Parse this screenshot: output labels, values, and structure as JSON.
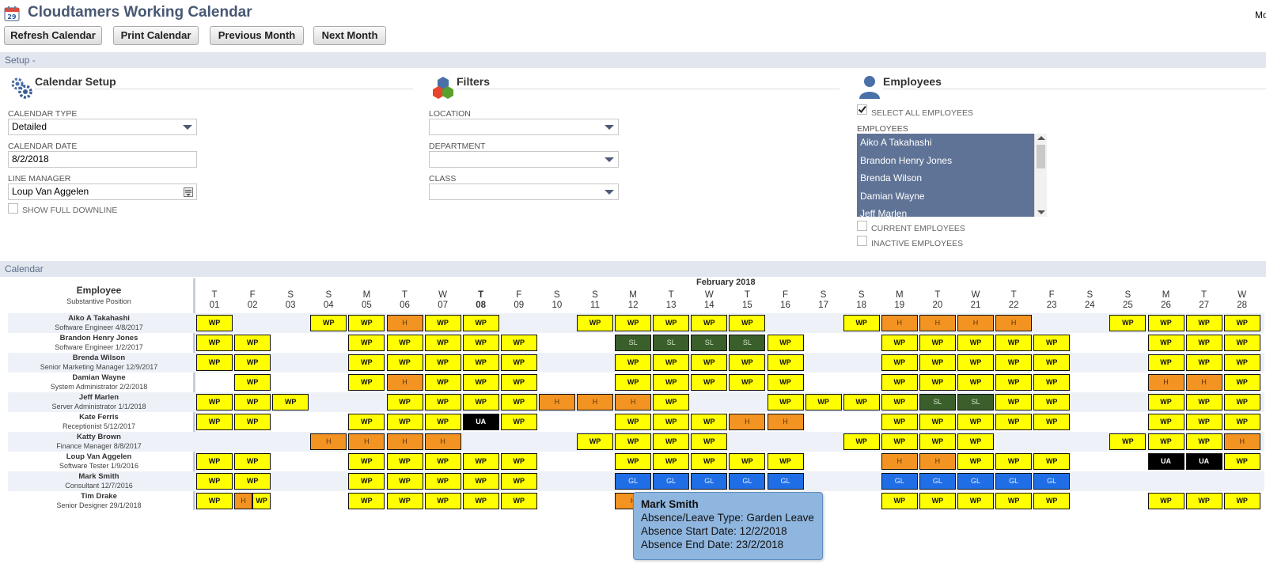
{
  "app": {
    "title": "Cloudtamers Working Calendar",
    "corner_text": "Mo"
  },
  "toolbar": {
    "refresh": "Refresh Calendar",
    "print": "Print Calendar",
    "previous": "Previous Month",
    "next": "Next Month"
  },
  "setup": {
    "bar_label": "Setup -",
    "calendar_setup": {
      "heading": "Calendar Setup",
      "calendar_type_label": "CALENDAR TYPE",
      "calendar_type_value": "Detailed",
      "calendar_date_label": "CALENDAR DATE",
      "calendar_date_value": "8/2/2018",
      "line_manager_label": "LINE MANAGER",
      "line_manager_value": "Loup Van Aggelen",
      "show_full_downline": "SHOW FULL DOWNLINE"
    },
    "filters": {
      "heading": "Filters",
      "location_label": "LOCATION",
      "department_label": "DEPARTMENT",
      "class_label": "CLASS"
    },
    "employees": {
      "heading": "Employees",
      "select_all": "SELECT ALL EMPLOYEES",
      "select_all_checked": true,
      "list_label": "EMPLOYEES",
      "list": [
        "Aiko A Takahashi",
        "Brandon Henry Jones",
        "Brenda Wilson",
        "Damian Wayne",
        "Jeff Marlen"
      ],
      "current_employees": "CURRENT EMPLOYEES",
      "inactive_employees": "INACTIVE EMPLOYEES"
    }
  },
  "calendar": {
    "bar_label": "Calendar",
    "month_label": "February 2018",
    "employee_header": "Employee",
    "employee_subheader": "Substantive Position",
    "days": [
      {
        "dow": "T",
        "num": "01"
      },
      {
        "dow": "F",
        "num": "02"
      },
      {
        "dow": "S",
        "num": "03"
      },
      {
        "dow": "S",
        "num": "04"
      },
      {
        "dow": "M",
        "num": "05"
      },
      {
        "dow": "T",
        "num": "06"
      },
      {
        "dow": "W",
        "num": "07"
      },
      {
        "dow": "T",
        "num": "08"
      },
      {
        "dow": "F",
        "num": "09"
      },
      {
        "dow": "S",
        "num": "10"
      },
      {
        "dow": "S",
        "num": "11"
      },
      {
        "dow": "M",
        "num": "12"
      },
      {
        "dow": "T",
        "num": "13"
      },
      {
        "dow": "W",
        "num": "14"
      },
      {
        "dow": "T",
        "num": "15"
      },
      {
        "dow": "F",
        "num": "16"
      },
      {
        "dow": "S",
        "num": "17"
      },
      {
        "dow": "S",
        "num": "18"
      },
      {
        "dow": "M",
        "num": "19"
      },
      {
        "dow": "T",
        "num": "20"
      },
      {
        "dow": "W",
        "num": "21"
      },
      {
        "dow": "T",
        "num": "22"
      },
      {
        "dow": "F",
        "num": "23"
      },
      {
        "dow": "S",
        "num": "24"
      },
      {
        "dow": "S",
        "num": "25"
      },
      {
        "dow": "M",
        "num": "26"
      },
      {
        "dow": "T",
        "num": "27"
      },
      {
        "dow": "W",
        "num": "28"
      }
    ],
    "highlight_day": "08",
    "legend_colors": {
      "WP": "#ffff00",
      "H": "#f39321",
      "SL": "#3b5f2b",
      "GL": "#1f6ee6",
      "UA": "#000000"
    },
    "rows": [
      {
        "name": "Aiko A Takahashi",
        "position": "Software Engineer 4/8/2017",
        "cells": [
          "WP",
          "",
          "",
          "WP",
          "WP",
          "H",
          "WP",
          "WP",
          "",
          "",
          "WP",
          "WP",
          "WP",
          "WP",
          "WP",
          "",
          "",
          "WP",
          "H",
          "H",
          "H",
          "H",
          "",
          "",
          "WP",
          "WP",
          "WP",
          "WP"
        ]
      },
      {
        "name": "Brandon Henry Jones",
        "position": "Software Engineer 1/2/2017",
        "cells": [
          "WP",
          "WP",
          "",
          "",
          "WP",
          "WP",
          "WP",
          "WP",
          "WP",
          "",
          "",
          "SL",
          "SL",
          "SL",
          "SL",
          "WP",
          "",
          "",
          "WP",
          "WP",
          "WP",
          "WP",
          "WP",
          "",
          "",
          "WP",
          "WP",
          "WP"
        ]
      },
      {
        "name": "Brenda Wilson",
        "position": "Senior Marketing Manager 12/9/2017",
        "cells": [
          "WP",
          "WP",
          "",
          "",
          "WP",
          "WP",
          "WP",
          "WP",
          "WP",
          "",
          "",
          "WP",
          "WP",
          "WP",
          "WP",
          "WP",
          "",
          "",
          "WP",
          "WP",
          "WP",
          "WP",
          "WP",
          "",
          "",
          "WP",
          "WP",
          "WP"
        ]
      },
      {
        "name": "Damian Wayne",
        "position": "System Administrator 2/2/2018",
        "cells": [
          "",
          "WP",
          "",
          "",
          "WP",
          "H",
          "WP",
          "WP",
          "WP",
          "",
          "",
          "WP",
          "WP",
          "WP",
          "WP",
          "WP",
          "",
          "",
          "WP",
          "WP",
          "WP",
          "WP",
          "WP",
          "",
          "",
          "H",
          "H",
          "WP"
        ]
      },
      {
        "name": "Jeff Marlen",
        "position": "Server Administrator 1/1/2018",
        "cells": [
          "WP",
          "WP",
          "WP",
          "",
          "",
          "WP",
          "WP",
          "WP",
          "WP",
          "H",
          "H",
          "H",
          "WP",
          "",
          "",
          "WP",
          "WP",
          "WP",
          "WP",
          "SL",
          "SL",
          "WP",
          "WP",
          "",
          "",
          "WP",
          "WP",
          "WP"
        ]
      },
      {
        "name": "Kate Ferris",
        "position": "Receptionist 5/12/2017",
        "cells": [
          "WP",
          "WP",
          "",
          "",
          "WP",
          "WP",
          "WP",
          "UA",
          "WP",
          "",
          "",
          "WP",
          "WP",
          "WP",
          "H",
          "H",
          "",
          "",
          "WP",
          "WP",
          "WP",
          "WP",
          "WP",
          "",
          "",
          "WP",
          "WP",
          "WP"
        ]
      },
      {
        "name": "Katty Brown",
        "position": "Finance Manager 8/8/2017",
        "cells": [
          "",
          "",
          "",
          "H",
          "H",
          "H",
          "H",
          "",
          "",
          "",
          "WP",
          "WP",
          "WP",
          "WP",
          "",
          "",
          "",
          "WP",
          "WP",
          "WP",
          "WP",
          "",
          "",
          "",
          "WP",
          "WP",
          "WP",
          "H"
        ]
      },
      {
        "name": "Loup Van Aggelen",
        "position": "Software Tester 1/9/2016",
        "cells": [
          "WP",
          "WP",
          "",
          "",
          "WP",
          "WP",
          "WP",
          "WP",
          "WP",
          "",
          "",
          "WP",
          "WP",
          "WP",
          "WP",
          "WP",
          "",
          "",
          "H",
          "H",
          "WP",
          "WP",
          "WP",
          "",
          "",
          "UA",
          "UA",
          "WP"
        ]
      },
      {
        "name": "Mark Smith",
        "position": "Consultant 12/7/2016",
        "cells": [
          "WP",
          "WP",
          "",
          "",
          "WP",
          "WP",
          "WP",
          "WP",
          "WP",
          "",
          "",
          "GL",
          "GL",
          "GL",
          "GL",
          "GL",
          "",
          "",
          "GL",
          "GL",
          "GL",
          "GL",
          "GL",
          "",
          "",
          "",
          "",
          ""
        ]
      },
      {
        "name": "Tim Drake",
        "position": "Senior Designer 29/1/2018",
        "cells": [
          "WP",
          "H|WP",
          "",
          "",
          "WP",
          "WP",
          "WP",
          "WP",
          "WP",
          "",
          "",
          "H",
          "",
          "",
          "",
          "",
          "",
          "",
          "WP",
          "WP",
          "WP",
          "WP",
          "WP",
          "",
          "",
          "WP",
          "WP",
          "WP"
        ]
      }
    ]
  },
  "tooltip": {
    "name": "Mark Smith",
    "type_line": "Absence/Leave Type: Garden Leave",
    "start_line": "Absence Start Date: 12/2/2018",
    "end_line": "Absence End Date: 23/2/2018"
  }
}
